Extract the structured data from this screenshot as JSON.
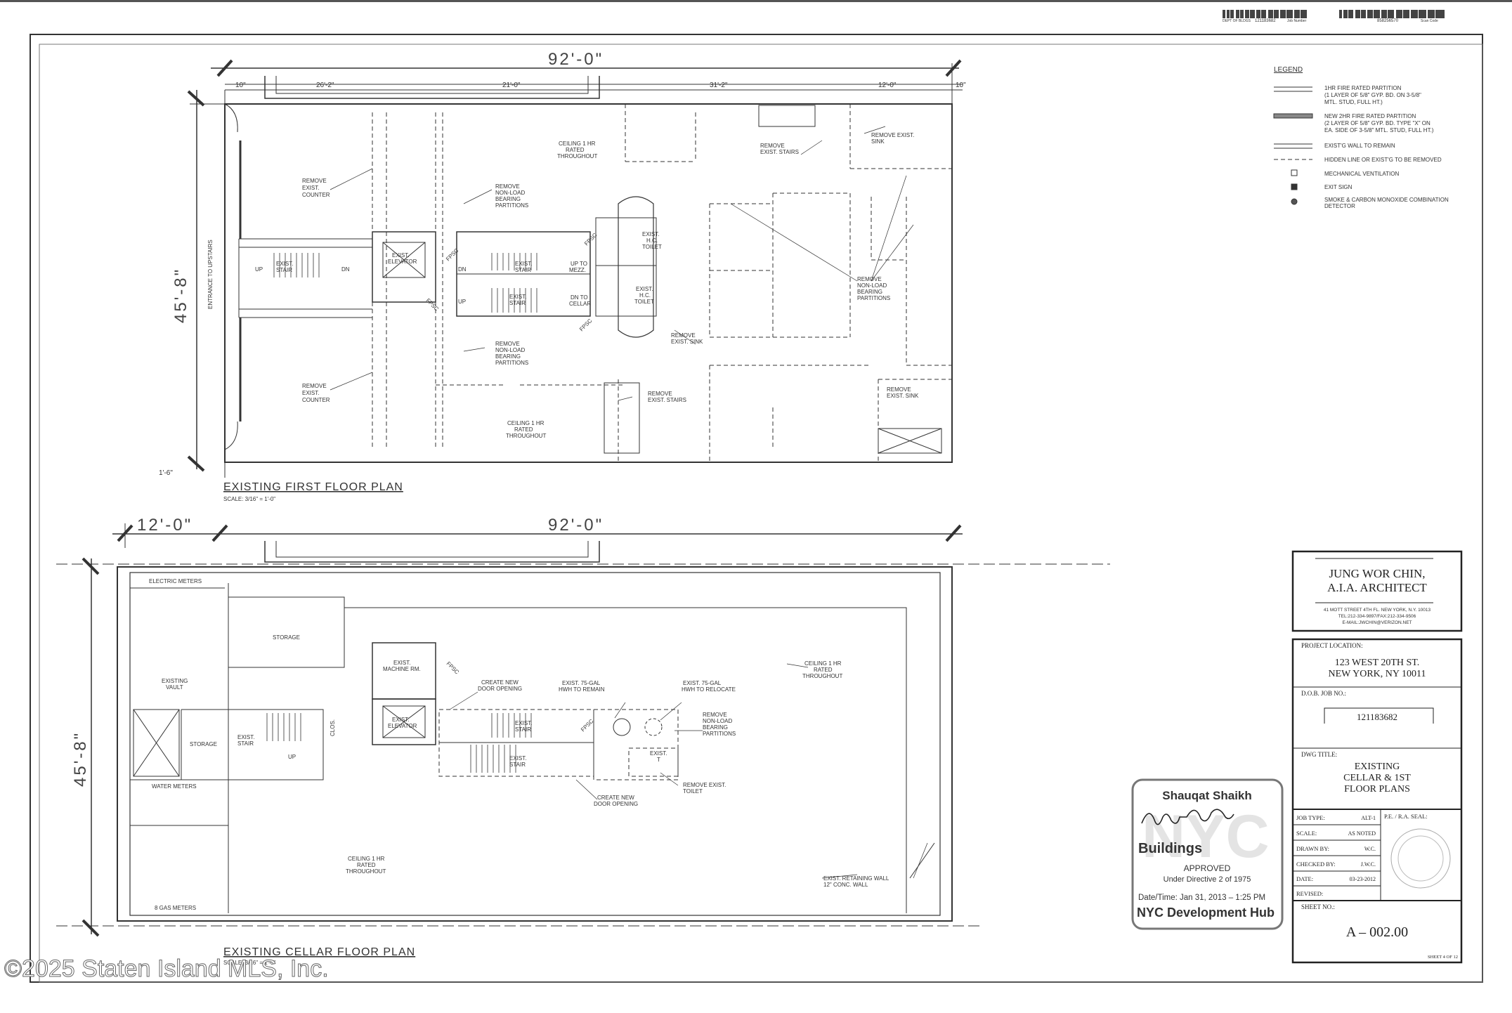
{
  "barcodes": {
    "job_number_label": "Job Number",
    "dob_label": "DEPT OF BLDGS",
    "dob_number": "121183682",
    "scan_code_label": "Scan Code",
    "scan_code": "858256570"
  },
  "first_floor": {
    "title": "EXISTING FIRST FLOOR PLAN",
    "scale": "SCALE: 3/16\" = 1'-0\"",
    "overall_width": "92'-0\"",
    "depth": "45'-8\"",
    "segments": [
      "10\"",
      "26'-2\"",
      "21'-0\"",
      "31'-2\"",
      "12'-0\"",
      "10\""
    ],
    "offset": "1'-6\"",
    "entrance": "ENTRANCE TO UPSTAIRS",
    "notes": {
      "remove_counter": [
        "REMOVE",
        "EXIST.",
        "COUNTER"
      ],
      "remove_partitions": [
        "REMOVE",
        "NON-LOAD",
        "BEARING",
        "PARTITIONS"
      ],
      "ceiling": [
        "CEILING 1 HR",
        "RATED",
        "THROUGHOUT"
      ],
      "remove_stairs": [
        "REMOVE",
        "EXIST. STAIRS"
      ],
      "remove_sink": [
        "REMOVE EXIST.",
        "SINK"
      ],
      "remove_sink2": [
        "REMOVE",
        "EXIST. SINK"
      ],
      "exist_stair": [
        "EXIST.",
        "STAIR"
      ],
      "exist_elevator": [
        "EXIST.",
        "ELEVATOR"
      ],
      "hc_toilet": [
        "EXIST.",
        "H.C.",
        "TOILET"
      ],
      "up_mezz": [
        "UP TO",
        "MEZZ."
      ],
      "dn_cellar": [
        "DN TO",
        "CELLAR"
      ],
      "up": "UP",
      "dn": "DN",
      "fpsc": "FPSC"
    }
  },
  "cellar": {
    "title": "EXISTING CELLAR FLOOR PLAN",
    "scale": "SCALE: 3/16\" = 1'-0\"",
    "overall_width": "92'-0\"",
    "left_width": "12'-0\"",
    "depth": "45'-8\"",
    "notes": {
      "electric_meters": "ELECTRIC METERS",
      "storage": "STORAGE",
      "existing_vault": [
        "EXISTING",
        "VAULT"
      ],
      "water_meters": "WATER METERS",
      "gas_meters": "8 GAS METERS",
      "machine_rm": [
        "EXIST.",
        "MACHINE RM."
      ],
      "create_door": [
        "CREATE NEW",
        "DOOR OPENING"
      ],
      "hwh_remain": [
        "EXIST. 75-GAL",
        "HWH TO REMAIN"
      ],
      "hwh_relocate": [
        "EXIST. 75-GAL",
        "HWH TO RELOCATE"
      ],
      "ceiling": [
        "CEILING 1 HR",
        "RATED",
        "THROUGHOUT"
      ],
      "retaining_wall": [
        "EXIST. RETAINING WALL",
        "12\" CONC. WALL"
      ],
      "remove_toilet": [
        "REMOVE EXIST.",
        "TOILET"
      ],
      "remove_partitions": [
        "REMOVE",
        "NON-LOAD",
        "BEARING",
        "PARTITIONS"
      ],
      "clos": "CLOS.",
      "exist_t": [
        "EXIST.",
        "T"
      ]
    }
  },
  "legend": {
    "title": "LEGEND",
    "items": [
      [
        "1HR FIRE RATED PARTITION",
        "(1 LAYER OF 5/8\" GYP. BD. ON 3-5/8\"",
        "MTL. STUD, FULL HT.)"
      ],
      [
        "NEW 2HR FIRE RATED PARTITION",
        "(2 LAYER OF 5/8\" GYP. BD. TYPE \"X\" ON",
        "EA. SIDE OF 3-5/8\" MTL. STUD, FULL HT.)"
      ],
      [
        "EXIST'G WALL TO REMAIN"
      ],
      [
        "HIDDEN LINE OR EXIST'G TO BE REMOVED"
      ],
      [
        "MECHANICAL VENTILATION"
      ],
      [
        "EXIT SIGN"
      ],
      [
        "SMOKE & CARBON MONOXIDE COMBINATION",
        "DETECTOR"
      ]
    ]
  },
  "title_block": {
    "architect": [
      "JUNG WOR CHIN,",
      "A.I.A. ARCHITECT"
    ],
    "address": "41 MOTT STREET 4TH FL. NEW YORK, N.Y. 10013",
    "tel": "TEL:212-334-9897/FAX:212-334-9506",
    "email": "E-MAIL:JWCHIN@VERIZON.NET",
    "project_location_label": "PROJECT LOCATION:",
    "project_location": [
      "123 WEST 20TH ST.",
      "NEW YORK, NY 10011"
    ],
    "dob_job_label": "D.O.B. JOB NO.:",
    "dob_job": "121183682",
    "dwg_title_label": "DWG TITLE:",
    "dwg_title": [
      "EXISTING",
      "CELLAR & 1ST",
      "FLOOR PLANS"
    ],
    "rows": [
      [
        "JOB TYPE:",
        "ALT-1"
      ],
      [
        "SCALE:",
        "AS NOTED"
      ],
      [
        "DRAWN BY:",
        "W.C."
      ],
      [
        "CHECKED BY:",
        "J.W.C."
      ],
      [
        "DATE:",
        "03-23-2012"
      ],
      [
        "REVISED:",
        ""
      ]
    ],
    "seal_label": "P.E. / R.A. SEAL:",
    "sheet_no_label": "SHEET NO.:",
    "sheet_no": "A  –  002.00",
    "sheet_of": "SHEET 4 OF 12"
  },
  "stamp": {
    "name": "Shauqat Shaikh",
    "signature": "Shauqat Shaikh",
    "agency": "Buildings",
    "status": "APPROVED",
    "directive": "Under Directive 2 of 1975",
    "datetime": "Date/Time: Jan 31, 2013 – 1:25 PM",
    "hub": "NYC Development Hub"
  },
  "watermark": "©2025 Staten Island MLS, Inc."
}
